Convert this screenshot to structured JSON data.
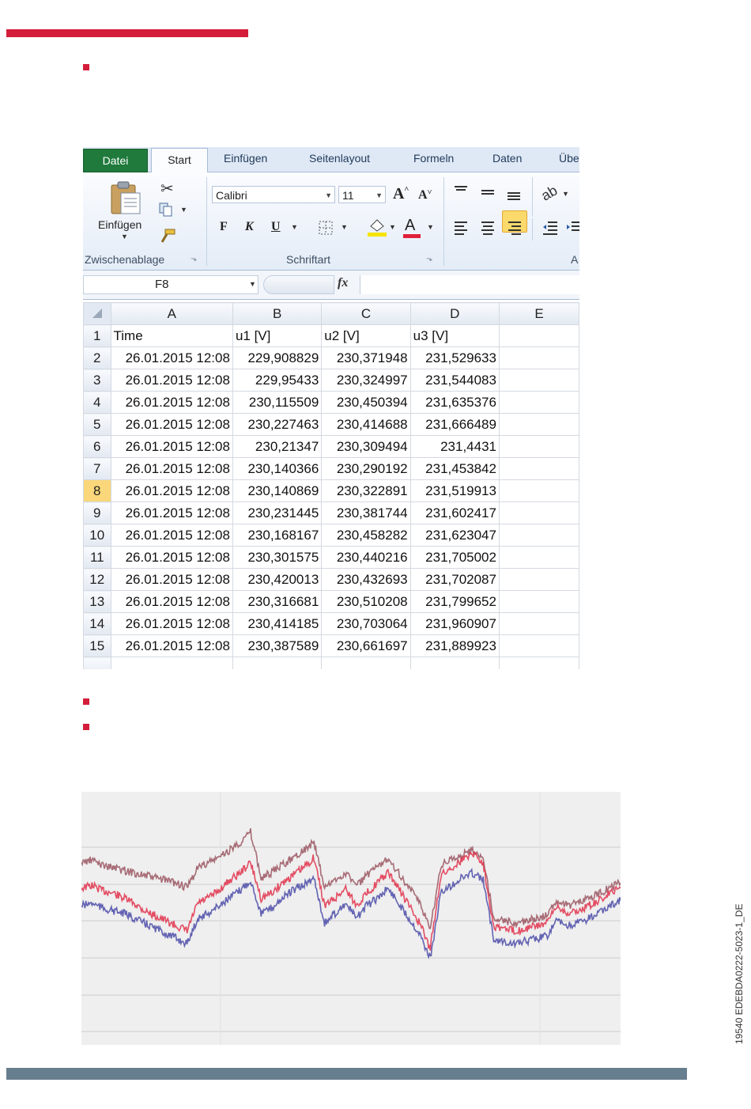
{
  "excel": {
    "tabs": [
      "Datei",
      "Start",
      "Einfügen",
      "Seitenlayout",
      "Formeln",
      "Daten",
      "Übe"
    ],
    "ribbon": {
      "paste_label": "Einfügen",
      "clipboard_group": "Zwischenablage",
      "font_group": "Schriftart",
      "next_group": "A",
      "font_name": "Calibri",
      "font_size": "11",
      "bold": "F",
      "italic": "K",
      "underline": "U"
    },
    "name_box": "F8",
    "fx": "fx",
    "columns": [
      "A",
      "B",
      "C",
      "D",
      "E"
    ],
    "selected_row": "8",
    "headers": [
      "Time",
      "u1 [V]",
      "u2 [V]",
      "u3 [V]",
      ""
    ],
    "rows": [
      {
        "n": "2",
        "time": "26.01.2015 12:08",
        "u1": "229,908829",
        "u2": "230,371948",
        "u3": "231,529633"
      },
      {
        "n": "3",
        "time": "26.01.2015 12:08",
        "u1": "229,95433",
        "u2": "230,324997",
        "u3": "231,544083"
      },
      {
        "n": "4",
        "time": "26.01.2015 12:08",
        "u1": "230,115509",
        "u2": "230,450394",
        "u3": "231,635376"
      },
      {
        "n": "5",
        "time": "26.01.2015 12:08",
        "u1": "230,227463",
        "u2": "230,414688",
        "u3": "231,666489"
      },
      {
        "n": "6",
        "time": "26.01.2015 12:08",
        "u1": "230,21347",
        "u2": "230,309494",
        "u3": "231,4431"
      },
      {
        "n": "7",
        "time": "26.01.2015 12:08",
        "u1": "230,140366",
        "u2": "230,290192",
        "u3": "231,453842"
      },
      {
        "n": "8",
        "time": "26.01.2015 12:08",
        "u1": "230,140869",
        "u2": "230,322891",
        "u3": "231,519913"
      },
      {
        "n": "9",
        "time": "26.01.2015 12:08",
        "u1": "230,231445",
        "u2": "230,381744",
        "u3": "231,602417"
      },
      {
        "n": "10",
        "time": "26.01.2015 12:08",
        "u1": "230,168167",
        "u2": "230,458282",
        "u3": "231,623047"
      },
      {
        "n": "11",
        "time": "26.01.2015 12:08",
        "u1": "230,301575",
        "u2": "230,440216",
        "u3": "231,705002"
      },
      {
        "n": "12",
        "time": "26.01.2015 12:08",
        "u1": "230,420013",
        "u2": "230,432693",
        "u3": "231,702087"
      },
      {
        "n": "13",
        "time": "26.01.2015 12:08",
        "u1": "230,316681",
        "u2": "230,510208",
        "u3": "231,799652"
      },
      {
        "n": "14",
        "time": "26.01.2015 12:08",
        "u1": "230,414185",
        "u2": "230,703064",
        "u3": "231,960907"
      },
      {
        "n": "15",
        "time": "26.01.2015 12:08",
        "u1": "230,387589",
        "u2": "230,661697",
        "u3": "231,889923"
      }
    ]
  },
  "doc_code": "19540 EDEBDA0222-5023-1_DE",
  "colors": {
    "accent_red": "#d41d3a",
    "footer_grey": "#677e8e",
    "series_blue": "#4a4aa8",
    "series_red": "#e0304a",
    "series_brown": "#9a5560"
  },
  "chart_data": {
    "type": "line",
    "series": [
      {
        "values": [
          0.62,
          0.63,
          0.61,
          0.6,
          0.58,
          0.56,
          0.53,
          0.51,
          0.49,
          0.47,
          0.45,
          0.56,
          0.58,
          0.61,
          0.65,
          0.68,
          0.72,
          0.58,
          0.6,
          0.64,
          0.67,
          0.7,
          0.74,
          0.55,
          0.58,
          0.62,
          0.55,
          0.6,
          0.64,
          0.68,
          0.62,
          0.55,
          0.48,
          0.38,
          0.67,
          0.7,
          0.73,
          0.76,
          0.72,
          0.47,
          0.46,
          0.45,
          0.46,
          0.47,
          0.48,
          0.55,
          0.52,
          0.53,
          0.55,
          0.57,
          0.6,
          0.62
        ]
      },
      {
        "values": [
          0.55,
          0.56,
          0.54,
          0.53,
          0.52,
          0.5,
          0.48,
          0.46,
          0.44,
          0.42,
          0.4,
          0.5,
          0.52,
          0.55,
          0.58,
          0.61,
          0.65,
          0.52,
          0.54,
          0.58,
          0.61,
          0.63,
          0.66,
          0.48,
          0.52,
          0.56,
          0.5,
          0.55,
          0.58,
          0.62,
          0.56,
          0.5,
          0.44,
          0.34,
          0.6,
          0.63,
          0.66,
          0.68,
          0.65,
          0.42,
          0.41,
          0.4,
          0.41,
          0.42,
          0.43,
          0.49,
          0.47,
          0.48,
          0.5,
          0.52,
          0.55,
          0.57
        ]
      },
      {
        "values": [
          0.72,
          0.73,
          0.71,
          0.7,
          0.69,
          0.68,
          0.67,
          0.66,
          0.65,
          0.64,
          0.62,
          0.7,
          0.72,
          0.74,
          0.77,
          0.8,
          0.84,
          0.66,
          0.68,
          0.71,
          0.74,
          0.77,
          0.8,
          0.62,
          0.65,
          0.68,
          0.63,
          0.67,
          0.7,
          0.74,
          0.68,
          0.62,
          0.56,
          0.46,
          0.71,
          0.73,
          0.75,
          0.77,
          0.74,
          0.5,
          0.49,
          0.48,
          0.49,
          0.5,
          0.51,
          0.57,
          0.55,
          0.56,
          0.58,
          0.6,
          0.62,
          0.64
        ]
      }
    ]
  }
}
